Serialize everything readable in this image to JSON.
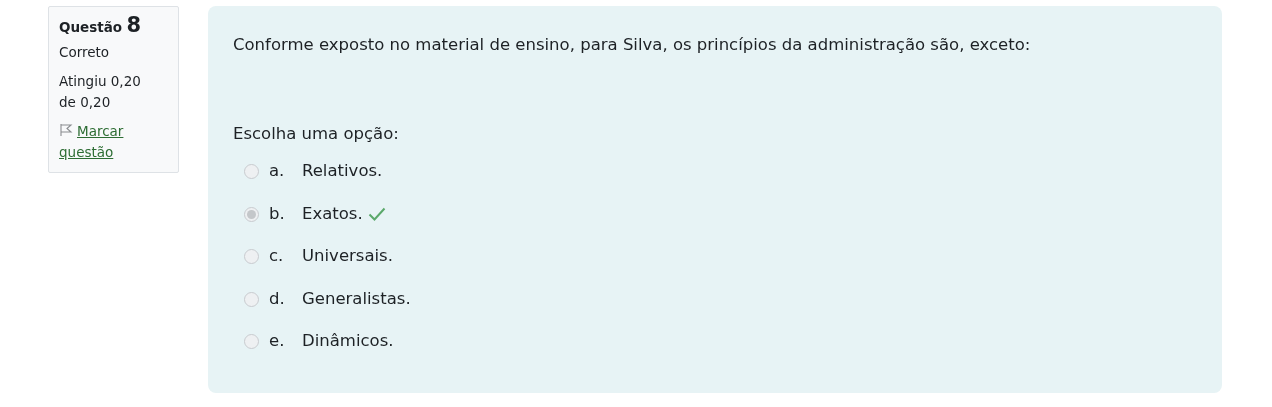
{
  "info": {
    "label": "Questão",
    "number": "8",
    "state": "Correto",
    "grade": "Atingiu 0,20 de 0,20",
    "flag_link": "Marcar questão"
  },
  "question": {
    "text": "Conforme exposto no material de ensino, para Silva, os princípios da administração são, exceto:",
    "prompt": "Escolha uma opção:",
    "options": [
      {
        "letter": "a.",
        "text": "Relativos.",
        "selected": false,
        "correct": false
      },
      {
        "letter": "b.",
        "text": "Exatos.",
        "selected": true,
        "correct": true
      },
      {
        "letter": "c.",
        "text": "Universais.",
        "selected": false,
        "correct": false
      },
      {
        "letter": "d.",
        "text": "Generalistas.",
        "selected": false,
        "correct": false
      },
      {
        "letter": "e.",
        "text": "Dinâmicos.",
        "selected": false,
        "correct": false
      }
    ]
  }
}
